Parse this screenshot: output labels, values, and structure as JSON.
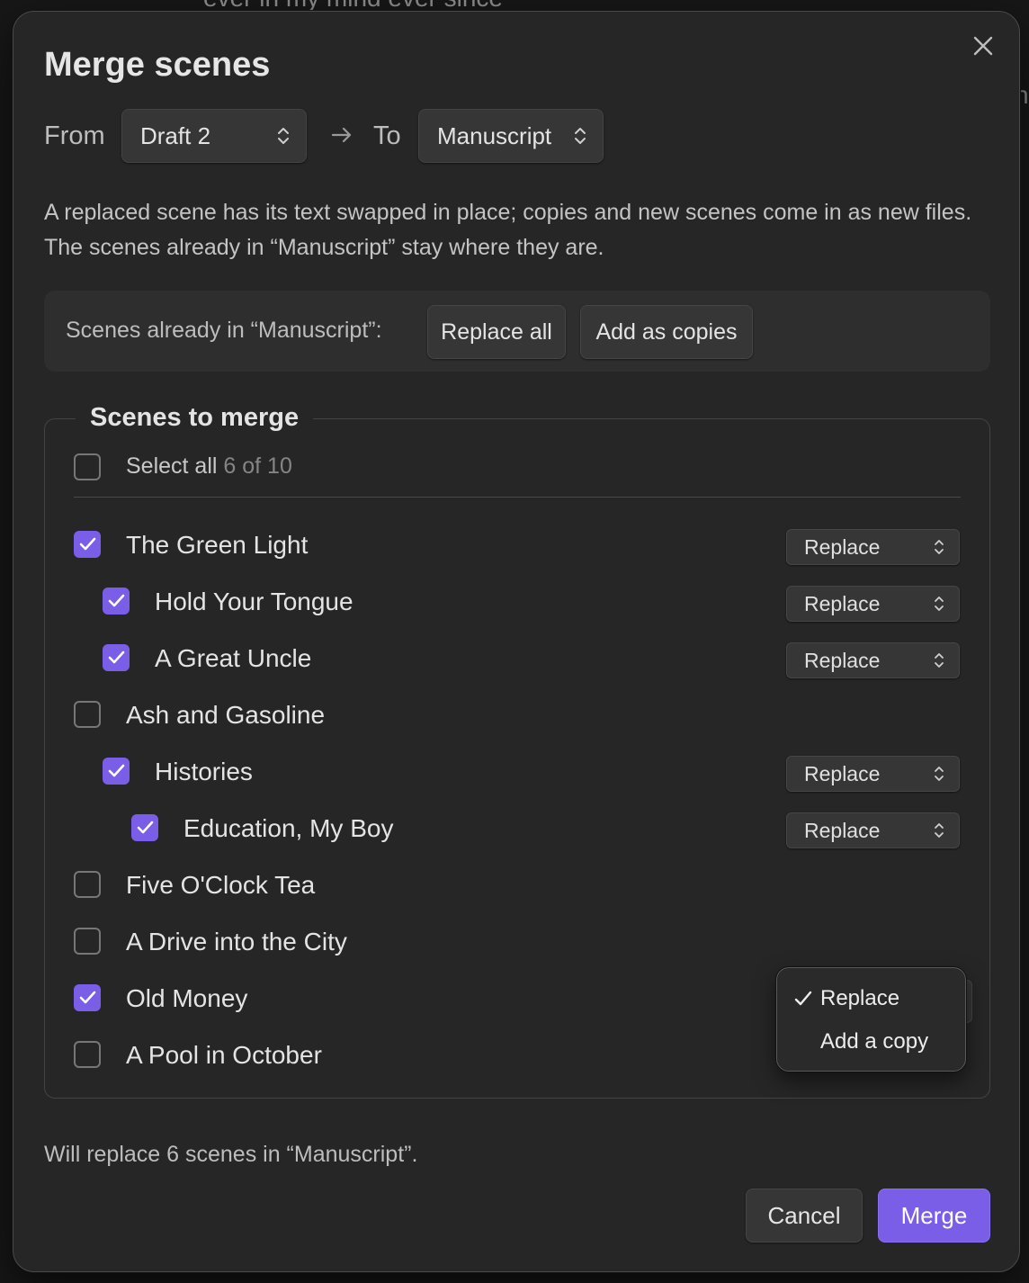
{
  "background": {
    "text_top": "ever in my mind ever since",
    "text_right": "n"
  },
  "dialog": {
    "title": "Merge scenes",
    "close_icon": "close-icon",
    "from_label": "From",
    "from_value": "Draft 2",
    "to_label": "To",
    "to_value": "Manuscript",
    "arrow_icon": "arrow-right-icon",
    "description": "A replaced scene has its text swapped in place; copies and new scenes come in as new files. The scenes already in “Manuscript” stay where they are.",
    "existing_label": "Scenes already in “Manuscript”:",
    "replace_all_label": "Replace all",
    "add_copies_label": "Add as copies",
    "scenes_legend": "Scenes to merge",
    "select_all_label": "Select all",
    "select_all_count": "6 of 10",
    "scenes": [
      {
        "title": "The Green Light",
        "checked": true,
        "action": "Replace"
      },
      {
        "title": "Hold Your Tongue",
        "checked": true,
        "action": "Replace"
      },
      {
        "title": "A Great Uncle",
        "checked": true,
        "action": "Replace"
      },
      {
        "title": "Ash and Gasoline",
        "checked": false,
        "action": ""
      },
      {
        "title": "Histories",
        "checked": true,
        "action": "Replace"
      },
      {
        "title": "Education, My Boy",
        "checked": true,
        "action": "Replace"
      },
      {
        "title": "Five O'Clock Tea",
        "checked": false,
        "action": ""
      },
      {
        "title": "A Drive into the City",
        "checked": false,
        "action": ""
      },
      {
        "title": "Old Money",
        "checked": true,
        "action": "Replace"
      },
      {
        "title": "A Pool in October",
        "checked": false,
        "action": ""
      }
    ],
    "dropdown": {
      "options": [
        "Replace",
        "Add a copy"
      ],
      "selected": "Replace"
    },
    "summary": "Will replace 6 scenes in “Manuscript”.",
    "cancel_label": "Cancel",
    "merge_label": "Merge"
  },
  "colors": {
    "accent": "#7b5ee8",
    "panel": "#262626",
    "button": "#363636"
  }
}
